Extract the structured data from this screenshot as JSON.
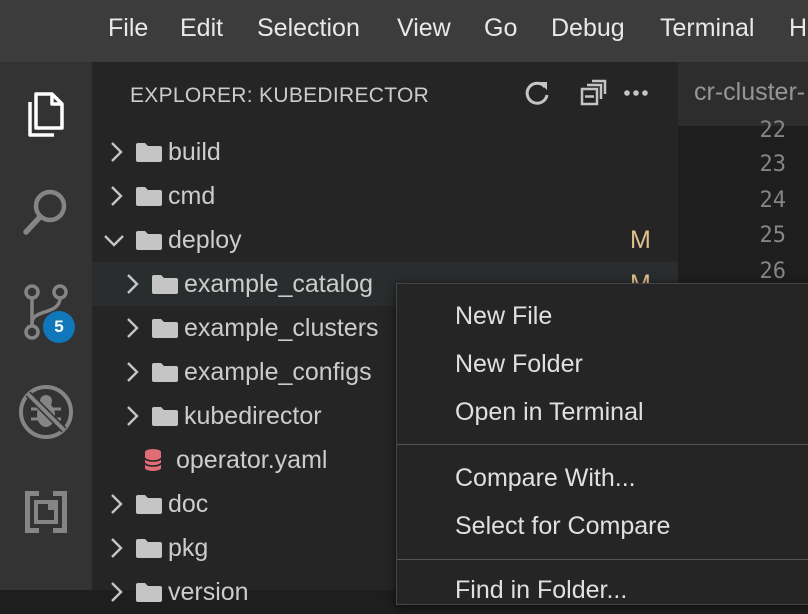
{
  "menubar": {
    "items": [
      "File",
      "Edit",
      "Selection",
      "View",
      "Go",
      "Debug",
      "Terminal",
      "H"
    ]
  },
  "activitybar": {
    "items": [
      {
        "icon": "files-icon"
      },
      {
        "icon": "search-icon"
      },
      {
        "icon": "source-control-icon",
        "badge": "5"
      },
      {
        "icon": "debug-disabled-icon"
      },
      {
        "icon": "extensions-icon"
      }
    ]
  },
  "explorer": {
    "title": "EXPLORER: KUBEDIRECTOR",
    "actions": [
      "refresh-icon",
      "collapse-all-icon",
      "more-icon"
    ],
    "tree": [
      {
        "label": "build",
        "type": "folder",
        "expanded": false,
        "depth": 0
      },
      {
        "label": "cmd",
        "type": "folder",
        "expanded": false,
        "depth": 0
      },
      {
        "label": "deploy",
        "type": "folder",
        "expanded": true,
        "depth": 0,
        "git": "M"
      },
      {
        "label": "example_catalog",
        "type": "folder",
        "expanded": false,
        "depth": 1,
        "git": "M"
      },
      {
        "label": "example_clusters",
        "type": "folder",
        "expanded": false,
        "depth": 1
      },
      {
        "label": "example_configs",
        "type": "folder",
        "expanded": false,
        "depth": 1
      },
      {
        "label": "kubedirector",
        "type": "folder",
        "expanded": false,
        "depth": 1
      },
      {
        "label": "operator.yaml",
        "type": "file",
        "depth": 1
      },
      {
        "label": "doc",
        "type": "folder",
        "expanded": false,
        "depth": 0
      },
      {
        "label": "pkg",
        "type": "folder",
        "expanded": false,
        "depth": 0
      },
      {
        "label": "version",
        "type": "folder",
        "expanded": false,
        "depth": 0
      }
    ]
  },
  "editor": {
    "tab_label": "cr-cluster-",
    "line_numbers": [
      "22",
      "23",
      "24",
      "25",
      "26"
    ]
  },
  "context_menu": {
    "groups": [
      [
        "New File",
        "New Folder",
        "Open in Terminal"
      ],
      [
        "Compare With...",
        "Select for Compare"
      ],
      [
        "Find in Folder..."
      ]
    ]
  },
  "colors": {
    "menubar": "#3c3c3c",
    "activitybar": "#333333",
    "sidebar": "#252526",
    "editor": "#1e1e1e",
    "badge": "#1177bb",
    "git_modified": "#e2c08d",
    "yaml_icon": "#e06c75"
  }
}
